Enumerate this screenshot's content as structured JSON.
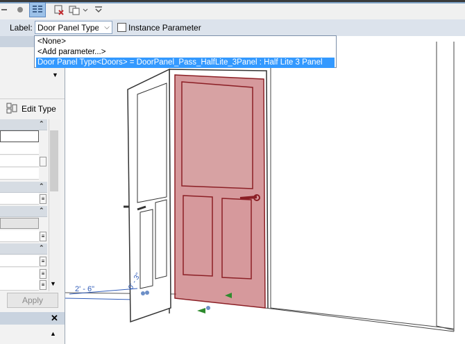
{
  "options_bar": {
    "label_caption": "Label:",
    "label_value": "Door Panel Type‹",
    "instance_parameter_label": "Instance Parameter",
    "instance_parameter_checked": false
  },
  "dropdown": {
    "items": [
      "<None>",
      "<Add parameter...>",
      "Door Panel Type<Doors> = DoorPanel_Pass_HalfLite_3Panel : Half Lite 3 Panel"
    ],
    "selected_index": 2
  },
  "properties": {
    "edit_type_label": "Edit Type",
    "apply_label": "Apply"
  },
  "viewport": {
    "dim_width": "2' - 6\"",
    "dim_small": "0' - 3\""
  },
  "colors": {
    "selection": "#3399ff",
    "door_highlight": "#b5454a",
    "dimension": "#2f5bb8"
  }
}
